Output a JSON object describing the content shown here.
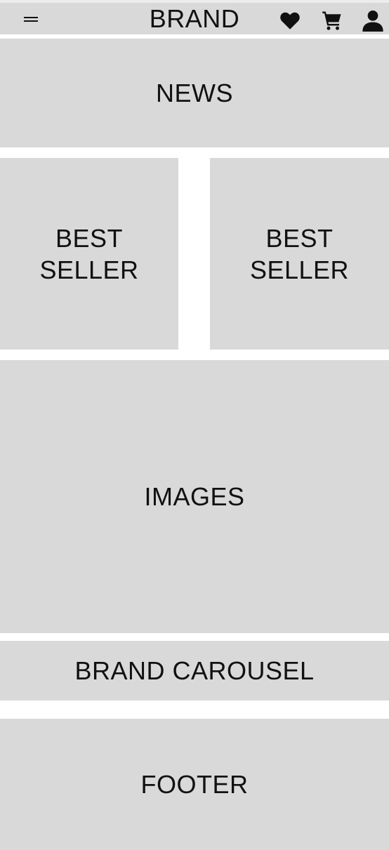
{
  "header": {
    "brand": "BRAND",
    "icons": {
      "menu": "hamburger-menu-icon",
      "favorites": "heart-icon",
      "cart": "cart-icon",
      "account": "user-icon"
    }
  },
  "sections": {
    "news": "NEWS",
    "best_seller_1": "BEST SELLER",
    "best_seller_2": "BEST SELLER",
    "images": "IMAGES",
    "brand_carousel": "BRAND CAROUSEL",
    "footer": "FOOTER"
  },
  "colors": {
    "placeholder_gray": "#d9d9d9",
    "background": "#ffffff",
    "text": "#111111"
  }
}
